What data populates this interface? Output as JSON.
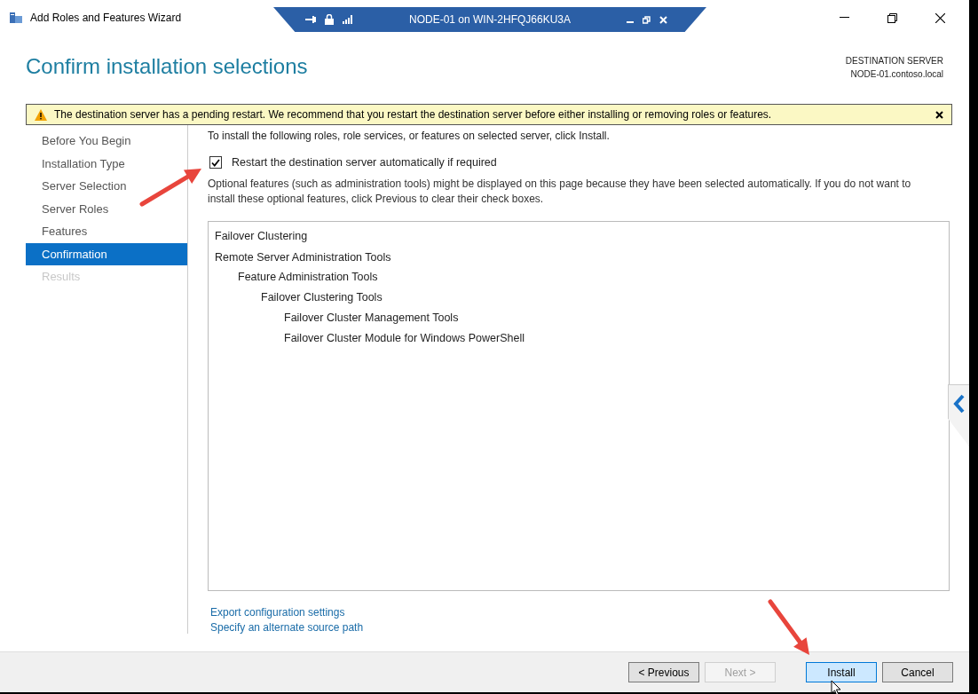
{
  "window": {
    "title": "Add Roles and Features Wizard"
  },
  "remote_bar": {
    "title": "NODE-01 on WIN-2HFQJ66KU3A"
  },
  "header": {
    "title": "Confirm installation selections",
    "destination_label": "DESTINATION SERVER",
    "destination_server": "NODE-01.contoso.local"
  },
  "warning": {
    "text": "The destination server has a pending restart. We recommend that you restart the destination server before either installing or removing roles or features."
  },
  "sidebar": {
    "items": [
      {
        "label": "Before You Begin",
        "selected": false,
        "disabled": false
      },
      {
        "label": "Installation Type",
        "selected": false,
        "disabled": false
      },
      {
        "label": "Server Selection",
        "selected": false,
        "disabled": false
      },
      {
        "label": "Server Roles",
        "selected": false,
        "disabled": false
      },
      {
        "label": "Features",
        "selected": false,
        "disabled": false
      },
      {
        "label": "Confirmation",
        "selected": true,
        "disabled": false
      },
      {
        "label": "Results",
        "selected": false,
        "disabled": true
      }
    ]
  },
  "content": {
    "intro": "To install the following roles, role services, or features on selected server, click Install.",
    "restart_checkbox": {
      "label": "Restart the destination server automatically if required",
      "checked": true
    },
    "note": "Optional features (such as administration tools) might be displayed on this page because they have been selected automatically. If you do not want to install these optional features, click Previous to clear their check boxes.",
    "selections": [
      {
        "label": "Failover Clustering"
      },
      {
        "label": "Remote Server Administration Tools",
        "children": [
          {
            "label": "Feature Administration Tools",
            "children": [
              {
                "label": "Failover Clustering Tools",
                "children": [
                  {
                    "label": "Failover Cluster Management Tools"
                  },
                  {
                    "label": "Failover Cluster Module for Windows PowerShell"
                  }
                ]
              }
            ]
          }
        ]
      }
    ],
    "links": [
      "Export configuration settings",
      "Specify an alternate source path"
    ]
  },
  "buttons": [
    {
      "label": "< Previous",
      "disabled": false,
      "highlighted": false
    },
    {
      "label": "Next >",
      "disabled": true,
      "highlighted": false
    },
    {
      "label": "Install",
      "disabled": false,
      "highlighted": true
    },
    {
      "label": "Cancel",
      "disabled": false,
      "highlighted": false
    }
  ]
}
